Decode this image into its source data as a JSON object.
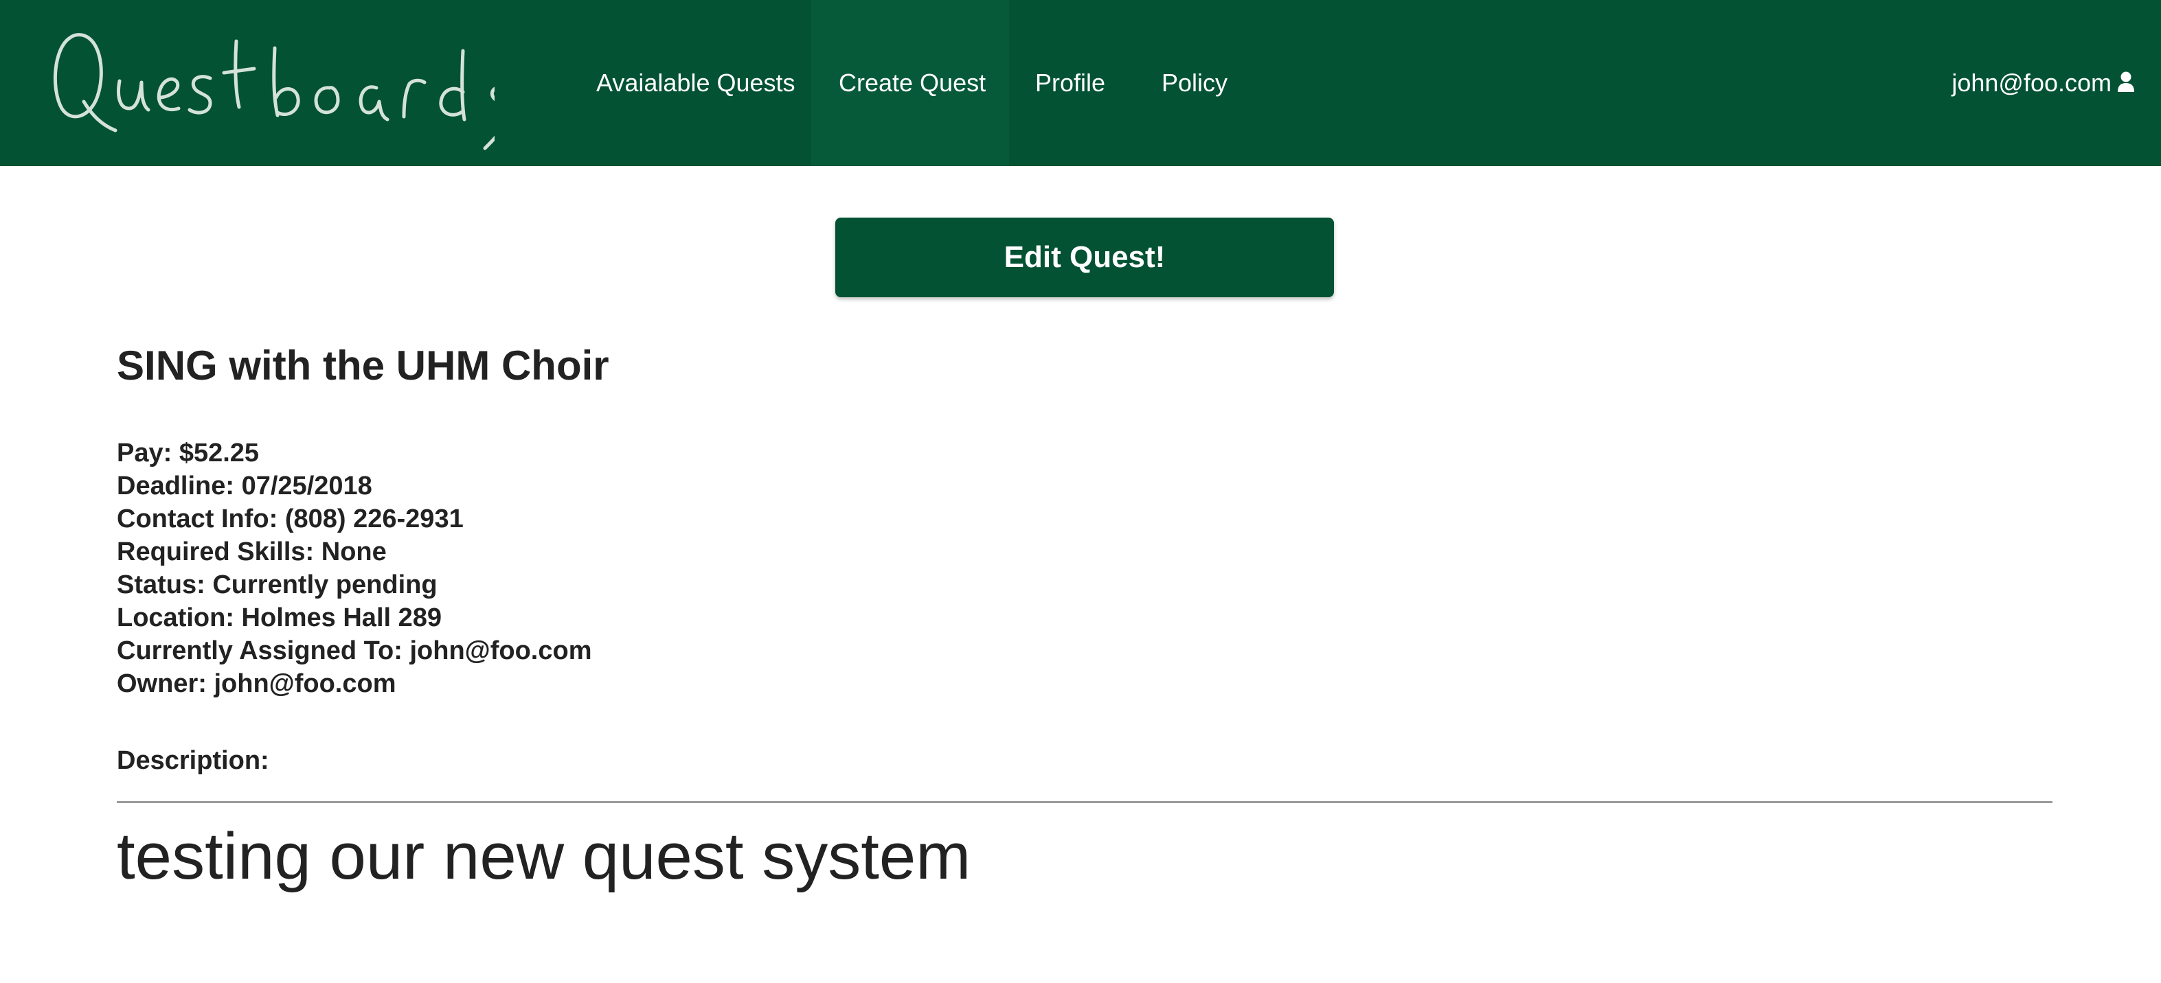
{
  "navbar": {
    "brand": "Questboards",
    "items": [
      {
        "label": "Avaialable Quests"
      },
      {
        "label": "Create Quest"
      },
      {
        "label": "Profile"
      },
      {
        "label": "Policy"
      }
    ],
    "user_email": "john@foo.com",
    "user_icon": "user-icon",
    "background_color": "#025233",
    "active_item_color": "#065a3a"
  },
  "main": {
    "edit_button_label": "Edit Quest!",
    "quest_title": "SING with the UHM Choir",
    "details": [
      "Pay: $52.25",
      "Deadline: 07/25/2018",
      "Contact Info: (808) 226-2931",
      "Required Skills: None",
      "Status: Currently pending",
      "Location: Holmes Hall 289",
      "Currently Assigned To: john@foo.com",
      "Owner: john@foo.com"
    ],
    "description_label": "Description:",
    "description_text": "testing our new quest system"
  }
}
